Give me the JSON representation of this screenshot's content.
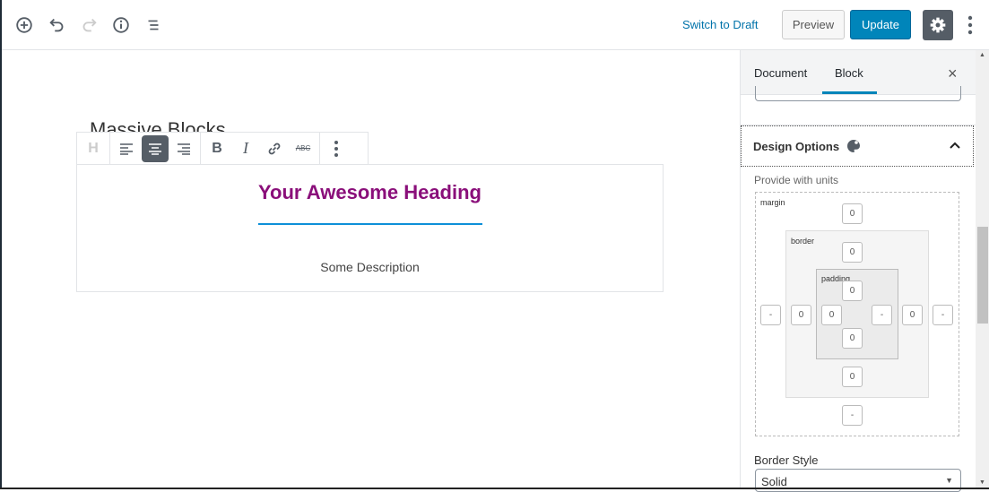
{
  "header": {
    "icons": [
      "add-block-icon",
      "undo-icon",
      "redo-icon",
      "info-icon",
      "outline-icon"
    ],
    "switch_to_draft": "Switch to Draft",
    "preview": "Preview",
    "update": "Update",
    "accent": "#0085ba"
  },
  "editor": {
    "block_title": "Massive Blocks",
    "toolbar": {
      "heading": "H",
      "strikethrough": "ABC",
      "active": "align-center"
    },
    "heading": "Your Awesome Heading",
    "heading_color": "#8a0f7a",
    "underline_color": "#0d8fd8",
    "description": "Some Description"
  },
  "sidebar": {
    "tabs": [
      {
        "label": "Document"
      },
      {
        "label": "Block",
        "active": true
      }
    ],
    "close": "×",
    "panel_title": "Design Options",
    "units_hint": "Provide with units",
    "box_labels": {
      "margin": "margin",
      "border": "border",
      "padding": "padding"
    },
    "spacing": {
      "margin": {
        "top": "0",
        "right": "-",
        "bottom": "-",
        "left": "-"
      },
      "border": {
        "top": "0",
        "right": "0",
        "bottom": "0",
        "left": "0"
      },
      "padding": {
        "top": "0",
        "right": "-",
        "bottom": "0",
        "left": "0"
      }
    },
    "border_style_label": "Border Style",
    "border_style_value": "Solid"
  }
}
